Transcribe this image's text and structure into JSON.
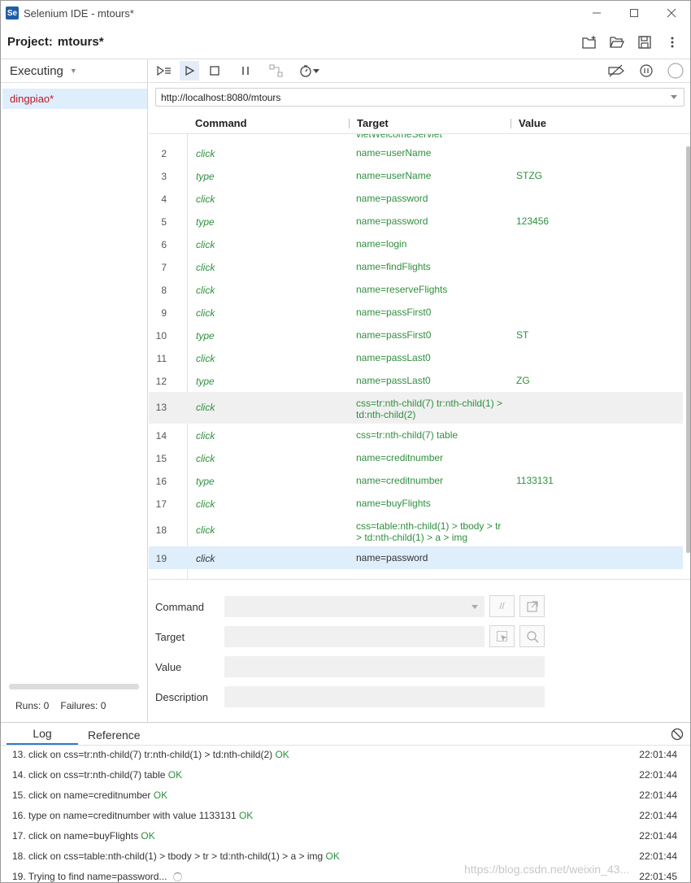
{
  "window": {
    "title": "Selenium IDE - mtours*",
    "logo": "Se",
    "controls": [
      "minimize-icon",
      "maximize-icon",
      "close-icon"
    ]
  },
  "project": {
    "label": "Project:",
    "name": "mtours*",
    "tools": [
      "new-suite-icon",
      "open-project-icon",
      "save-icon",
      "more-icon"
    ]
  },
  "sidebar": {
    "header": "Executing",
    "tests": [
      "dingpiao*"
    ],
    "runs_label": "Runs: 0",
    "failures_label": "Failures: 0"
  },
  "toolbar": {
    "buttons": [
      "run-all-icon",
      "run-current-icon",
      "stop-icon",
      "pause-icon",
      "step-icon",
      "speed-icon"
    ],
    "right_buttons": [
      "disable-breakpoints-icon",
      "pause-on-exception-icon",
      "record-icon"
    ],
    "record_text": "REC"
  },
  "url": "http://localhost:8080/mtours",
  "grid": {
    "columns": [
      "Command",
      "Target",
      "Value"
    ],
    "partial_target": "vletWelcomeServlet",
    "rows": [
      {
        "num": "2",
        "cmd": "click",
        "target": "name=userName",
        "value": ""
      },
      {
        "num": "3",
        "cmd": "type",
        "target": "name=userName",
        "value": "STZG"
      },
      {
        "num": "4",
        "cmd": "click",
        "target": "name=password",
        "value": ""
      },
      {
        "num": "5",
        "cmd": "type",
        "target": "name=password",
        "value": "123456"
      },
      {
        "num": "6",
        "cmd": "click",
        "target": "name=login",
        "value": ""
      },
      {
        "num": "7",
        "cmd": "click",
        "target": "name=findFlights",
        "value": ""
      },
      {
        "num": "8",
        "cmd": "click",
        "target": "name=reserveFlights",
        "value": ""
      },
      {
        "num": "9",
        "cmd": "click",
        "target": "name=passFirst0",
        "value": ""
      },
      {
        "num": "10",
        "cmd": "type",
        "target": "name=passFirst0",
        "value": "ST"
      },
      {
        "num": "11",
        "cmd": "click",
        "target": "name=passLast0",
        "value": ""
      },
      {
        "num": "12",
        "cmd": "type",
        "target": "name=passLast0",
        "value": "ZG"
      },
      {
        "num": "13",
        "cmd": "click",
        "target": "css=tr:nth-child(7) tr:nth-child(1) > td:nth-child(2)",
        "value": ""
      },
      {
        "num": "14",
        "cmd": "click",
        "target": "css=tr:nth-child(7) table",
        "value": ""
      },
      {
        "num": "15",
        "cmd": "click",
        "target": "name=creditnumber",
        "value": ""
      },
      {
        "num": "16",
        "cmd": "type",
        "target": "name=creditnumber",
        "value": "1133131"
      },
      {
        "num": "17",
        "cmd": "click",
        "target": "name=buyFlights",
        "value": ""
      },
      {
        "num": "18",
        "cmd": "click",
        "target": "css=table:nth-child(1) > tbody > tr > td:nth-child(1) > a > img",
        "value": ""
      },
      {
        "num": "19",
        "cmd": "click",
        "target": "name=password",
        "value": ""
      }
    ]
  },
  "editor": {
    "command_label": "Command",
    "target_label": "Target",
    "value_label": "Value",
    "description_label": "Description",
    "comment_btn": "//"
  },
  "log": {
    "tabs": [
      "Log",
      "Reference"
    ],
    "entries": [
      {
        "text": "13. click on css=tr:nth-child(7) tr:nth-child(1) > td:nth-child(2) ",
        "status": "OK",
        "time": "22:01:44"
      },
      {
        "text": "14. click on css=tr:nth-child(7) table ",
        "status": "OK",
        "time": "22:01:44"
      },
      {
        "text": "15. click on name=creditnumber ",
        "status": "OK",
        "time": "22:01:44"
      },
      {
        "text": "16. type on name=creditnumber with value 1133131 ",
        "status": "OK",
        "time": "22:01:44"
      },
      {
        "text": "17. click on name=buyFlights ",
        "status": "OK",
        "time": "22:01:44"
      },
      {
        "text": "18. click on css=table:nth-child(1) > tbody > tr > td:nth-child(1) > a > img ",
        "status": "OK",
        "time": "22:01:44"
      },
      {
        "text": "19. Trying to find name=password...",
        "status": "",
        "time": "22:01:45"
      }
    ],
    "watermark": "https://blog.csdn.net/weixin_43..."
  }
}
